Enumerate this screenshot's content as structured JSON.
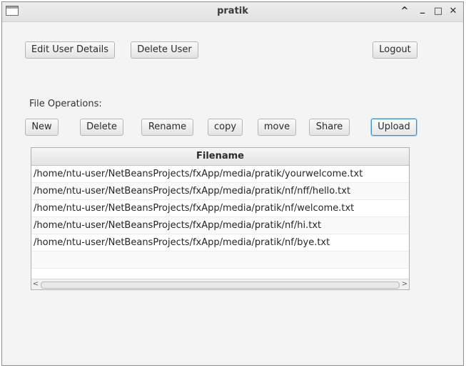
{
  "window": {
    "title": "pratik",
    "controls": {
      "minimize_up": "^",
      "minimize": "_",
      "maximize": "□",
      "close": "✕"
    }
  },
  "top_buttons": {
    "edit_user_details": "Edit User Details",
    "delete_user": "Delete User",
    "logout": "Logout"
  },
  "file_operations": {
    "label": "File Operations:",
    "buttons": {
      "new": "New",
      "delete": "Delete",
      "rename": "Rename",
      "copy": "copy",
      "move": "move",
      "share": "Share",
      "upload": "Upload"
    }
  },
  "table": {
    "column_header": "Filename",
    "rows": [
      "/home/ntu-user/NetBeansProjects/fxApp/media/pratik/yourwelcome.txt",
      "/home/ntu-user/NetBeansProjects/fxApp/media/pratik/nf/nff/hello.txt",
      "/home/ntu-user/NetBeansProjects/fxApp/media/pratik/nf/welcome.txt",
      "/home/ntu-user/NetBeansProjects/fxApp/media/pratik/nf/hi.txt",
      "/home/ntu-user/NetBeansProjects/fxApp/media/pratik/nf/bye.txt"
    ],
    "scroll_left": "<",
    "scroll_right": ">"
  },
  "colors": {
    "focus_border": "#3c8ed6",
    "window_bg": "#f4f4f4"
  }
}
